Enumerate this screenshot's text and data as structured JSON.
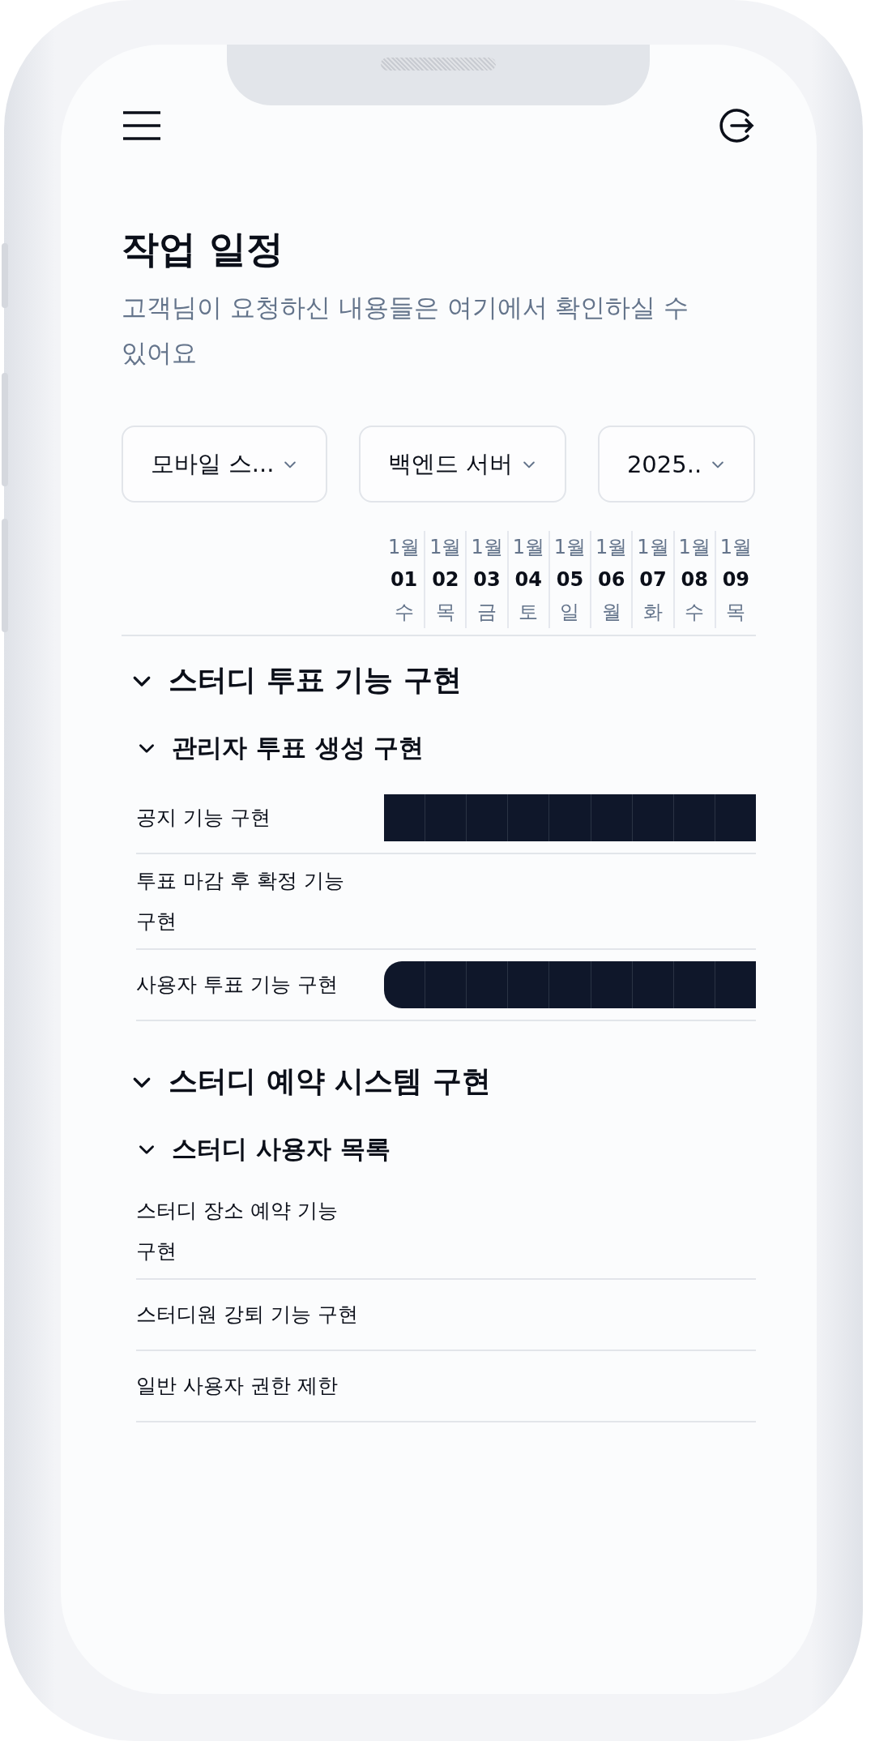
{
  "title": "작업 일정",
  "subtitle": "고객님이 요청하신 내용들은 여기에서 확인하실 수 있어요",
  "filters": [
    {
      "value": "모바일 스..."
    },
    {
      "value": "백엔드 서버"
    },
    {
      "value": "2025.."
    }
  ],
  "dates": [
    {
      "month": "1월",
      "day": "01",
      "weekday": "수"
    },
    {
      "month": "1월",
      "day": "02",
      "weekday": "목"
    },
    {
      "month": "1월",
      "day": "03",
      "weekday": "금"
    },
    {
      "month": "1월",
      "day": "04",
      "weekday": "토"
    },
    {
      "month": "1월",
      "day": "05",
      "weekday": "일"
    },
    {
      "month": "1월",
      "day": "06",
      "weekday": "월"
    },
    {
      "month": "1월",
      "day": "07",
      "weekday": "화"
    },
    {
      "month": "1월",
      "day": "08",
      "weekday": "수"
    },
    {
      "month": "1월",
      "day": "09",
      "weekday": "목"
    }
  ],
  "groups": [
    {
      "title": "스터디 투표 기능 구현",
      "expanded": true,
      "subgroups": [
        {
          "title": "관리자 투표 생성 구현",
          "expanded": true,
          "tasks": [
            {
              "name": "공지 기능 구현",
              "has_bar": true,
              "bar_rounded_start": false
            },
            {
              "name": "투표 마감 후 확정 기능 구현",
              "has_bar": false
            },
            {
              "name": "사용자 투표 기능 구현",
              "has_bar": true,
              "bar_rounded_start": true
            }
          ]
        }
      ]
    },
    {
      "title": "스터디 예약 시스템 구현",
      "expanded": true,
      "subgroups": [
        {
          "title": "스터디 사용자 목록",
          "expanded": true,
          "tasks": [
            {
              "name": "스터디 장소 예약 기능 구현",
              "has_bar": false
            },
            {
              "name": "스터디원 강퇴 기능 구현",
              "has_bar": false
            },
            {
              "name": "일반 사용자 권한 제한",
              "has_bar": false
            }
          ]
        }
      ]
    }
  ]
}
